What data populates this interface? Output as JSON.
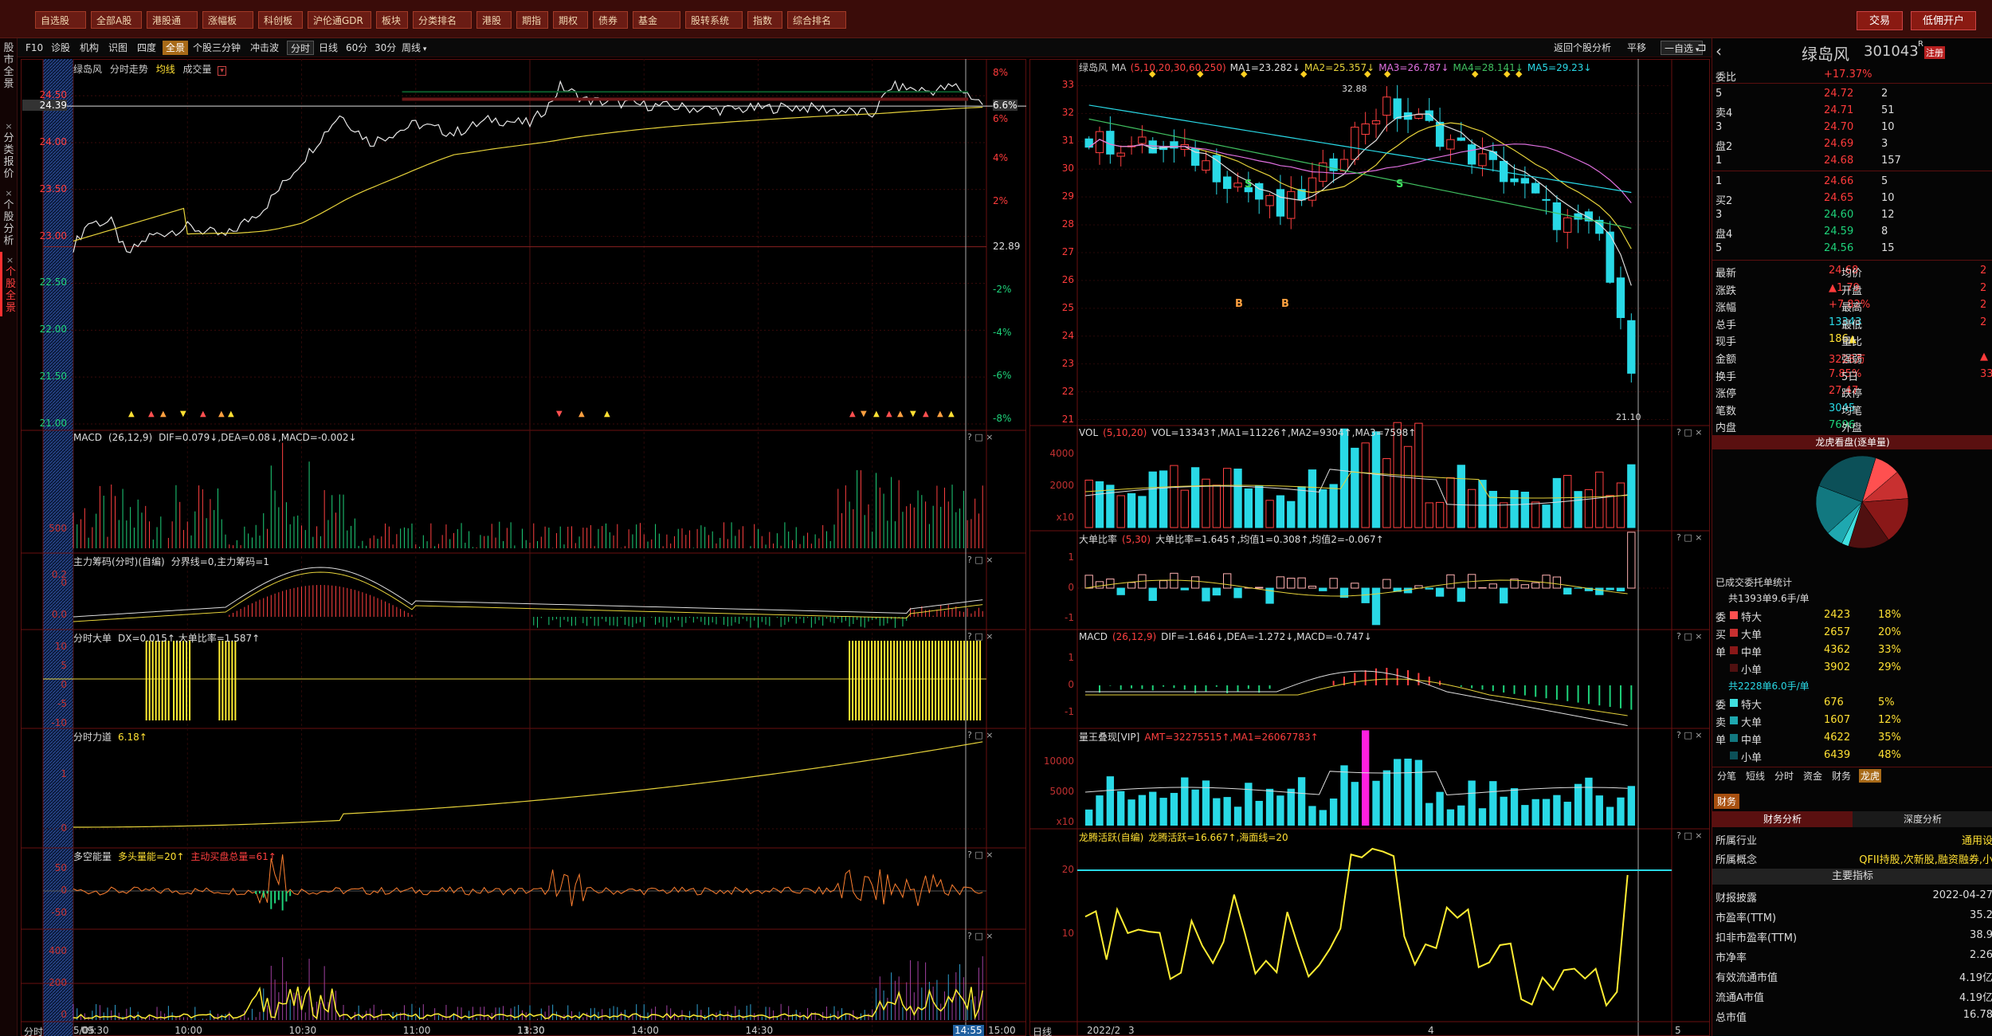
{
  "topbar": {
    "buttons": [
      "自选股",
      "全部A股",
      "港股通",
      "涨幅板",
      "科创板",
      "沪伦通GDR",
      "板块",
      "分类排名",
      "港股",
      "期指",
      "期权",
      "债券",
      "基金",
      "股转系统",
      "指数",
      "综合排名"
    ],
    "trade_label": "交易",
    "open_account_label": "低佣开户"
  },
  "left_tabs": [
    "股市全景",
    "分类报价",
    "个股分析",
    "个股全景"
  ],
  "toolbar": {
    "items": [
      "F10",
      "诊股",
      "机构",
      "识图",
      "四度"
    ],
    "all_label": "全景",
    "items2": [
      "个股三分钟",
      "冲击波"
    ],
    "periods": [
      "分时",
      "日线",
      "60分",
      "30分",
      "周线"
    ],
    "back_label": "返回个股分析",
    "flat_label": "平移",
    "self_select": "一自选"
  },
  "intraday": {
    "title": "绿岛风",
    "subtitle": "分时走势",
    "legend_avg": "均线",
    "legend_vol": "成交量",
    "price_ticks": [
      "24.50",
      "24.39",
      "24.00",
      "23.50",
      "23.00",
      "22.50",
      "22.00",
      "21.50",
      "21.00"
    ],
    "pct_ticks": [
      "8%",
      "6.6%",
      "6%",
      "4%",
      "2%",
      "22.89",
      "-2%",
      "-4%",
      "-6%",
      "-8%"
    ],
    "vol_ticks": [
      "500",
      "0"
    ],
    "macd_title": "MACD",
    "macd_params": "(26,12,9)",
    "macd_vals": "DIF=0.079↓,DEA=0.08↓,MACD=-0.002↓",
    "macd_ticks": [
      "0.2",
      "0.0"
    ],
    "zl_title": "主力筹码(分时)(自编)",
    "zl_vals": "分界线=0,主力筹码=1",
    "zl_ticks": [
      "10",
      "5",
      "0",
      "-5",
      "-10"
    ],
    "dd_title": "分时大单",
    "dd_vals": "DX=0.015↑,大单比率=1.587↑",
    "dd_ticks": [
      "1",
      "0"
    ],
    "ld_title": "分时力道",
    "ld_vals": "6.18↑",
    "ld_ticks": [
      "50",
      "0",
      "-50"
    ],
    "dk_title": "多空能量",
    "dk_vals": "多头量能=20↑",
    "dk_vals2": "主动买盘总量=61↑",
    "dk_ticks": [
      "400",
      "200",
      "0"
    ],
    "x_labels": [
      "5/05",
      "09:30",
      "10:00",
      "10:30",
      "11:00",
      "11:30",
      "13:30",
      "14:00",
      "14:30",
      "14:55",
      "15:00"
    ],
    "time_btn": "分时"
  },
  "daily": {
    "title": "绿岛风",
    "ma_label": "MA",
    "ma_params": "(5,10,20,30,60,250)",
    "ma1": "MA1=23.282↓",
    "ma2": "MA2=25.357↓",
    "ma3": "MA3=26.787↓",
    "ma4": "MA4=28.141↓",
    "ma5": "MA5=29.23↓",
    "price_ticks": [
      "33",
      "32",
      "31",
      "30",
      "29",
      "28",
      "27",
      "26",
      "25",
      "24",
      "23",
      "22",
      "21"
    ],
    "hi_label": "32.88",
    "lo_label": "21.10",
    "vol_title": "VOL",
    "vol_params": "(5,10,20)",
    "vol_vals": "VOL=13343↑,MA1=11226↑,MA2=9304↑,MA3=7598↑",
    "vol_ticks": [
      "4000",
      "2000",
      "x10"
    ],
    "dd_title": "大单比率",
    "dd_params": "(5,30)",
    "dd_vals": "大单比率=1.645↑,均值1=0.308↑,均值2=-0.067↑",
    "dd_ticks": [
      "1",
      "0",
      "-1"
    ],
    "macd_title": "MACD",
    "macd_params": "(26,12,9)",
    "macd_vals": "DIF=-1.646↓,DEA=-1.272↓,MACD=-0.747↓",
    "macd_ticks": [
      "1",
      "0",
      "-1"
    ],
    "lw_title": "量王叠现[VIP]",
    "lw_vals": "AMT=32275515↑,MA1=26067783↑",
    "lw_ticks": [
      "10000",
      "5000",
      "x10"
    ],
    "lh_title": "龙腾活跃(自编)",
    "lh_vals": "龙腾活跃=16.667↑,海面线=20",
    "lh_ticks": [
      "20",
      "10"
    ],
    "x_labels": [
      "日线",
      "2022/2",
      "3",
      "4",
      "5"
    ],
    "s_marks": [
      "S",
      "S"
    ],
    "b_marks": [
      "B",
      "B"
    ]
  },
  "quote": {
    "name": "绿岛风",
    "code": "301043",
    "badge": "注册",
    "weibi_label": "委比",
    "weibi_val": "+17.37%",
    "asks": [
      [
        "卖5",
        "24.72",
        "2"
      ],
      [
        "卖4",
        "24.71",
        "51"
      ],
      [
        "卖3",
        "24.70",
        "10"
      ],
      [
        "卖2",
        "24.69",
        "3"
      ],
      [
        "卖1",
        "24.68",
        "157"
      ]
    ],
    "bids": [
      [
        "买1",
        "24.66",
        "5"
      ],
      [
        "买2",
        "24.65",
        "10"
      ],
      [
        "买3",
        "24.60",
        "12"
      ],
      [
        "买4",
        "24.59",
        "8"
      ],
      [
        "买5",
        "24.56",
        "15"
      ]
    ],
    "stats": [
      [
        "最新",
        "24.68",
        "均价",
        "2"
      ],
      [
        "涨跌",
        "▲1.79",
        "开盘",
        "2"
      ],
      [
        "涨幅",
        "+7.82%",
        "最高",
        "2"
      ],
      [
        "总手",
        "13343",
        "最低",
        "2"
      ],
      [
        "现手",
        "186▲",
        "量比",
        ""
      ],
      [
        "金额",
        "3228万",
        "强弱",
        "▲"
      ],
      [
        "换手",
        "7.85%",
        "5日",
        "33."
      ],
      [
        "涨停",
        "27.47",
        "跌停",
        ""
      ],
      [
        "笔数",
        "3045",
        "均笔",
        ""
      ],
      [
        "内盘",
        "7696",
        "外盘",
        ""
      ]
    ],
    "lhb_title": "龙虎看盘(逐单量)",
    "order_stats_title": "已成交委托单统计",
    "buy_total": "共1393单9.6手/单",
    "buy_rows": [
      [
        "委",
        "特大",
        "2423",
        "18%"
      ],
      [
        "买",
        "大单",
        "2657",
        "20%"
      ],
      [
        "单",
        "中单",
        "4362",
        "33%"
      ],
      [
        "",
        "小单",
        "3902",
        "29%"
      ]
    ],
    "sell_total": "共2228单6.0手/单",
    "sell_rows": [
      [
        "委",
        "特大",
        "676",
        "5%"
      ],
      [
        "卖",
        "大单",
        "1607",
        "12%"
      ],
      [
        "单",
        "中单",
        "4622",
        "35%"
      ],
      [
        "",
        "小单",
        "6439",
        "48%"
      ]
    ],
    "tabs": [
      "分笔",
      "短线",
      "分时",
      "资金",
      "财务",
      "龙虎"
    ],
    "fin_tab": "财务",
    "fin_tabs": [
      "财务分析",
      "深度分析"
    ],
    "industry_label": "所属行业",
    "industry_val": "通用设",
    "concept_label": "所属概念",
    "concept_val": "QFII持股,次新股,融资融券,小",
    "main_index": "主要指标",
    "fin_rows": [
      [
        "财报披露",
        "2022-04-27"
      ],
      [
        "市盈率(TTM)",
        "35.2"
      ],
      [
        "扣非市盈率(TTM)",
        "38.9"
      ],
      [
        "市净率",
        "2.26"
      ],
      [
        "有效流通市值",
        "4.19亿"
      ],
      [
        "流通A市值",
        "4.19亿"
      ],
      [
        "总市值",
        "16.78"
      ]
    ]
  },
  "pie": {
    "slices": [
      {
        "v": 18,
        "c": "#ff5050"
      },
      {
        "v": 20,
        "c": "#c83030"
      },
      {
        "v": 33,
        "c": "#8a1818"
      },
      {
        "v": 29,
        "c": "#501010"
      },
      {
        "v": 5,
        "c": "#40e0e0"
      },
      {
        "v": 12,
        "c": "#1fa8b0"
      },
      {
        "v": 35,
        "c": "#127880"
      },
      {
        "v": 48,
        "c": "#0c5058"
      }
    ]
  }
}
